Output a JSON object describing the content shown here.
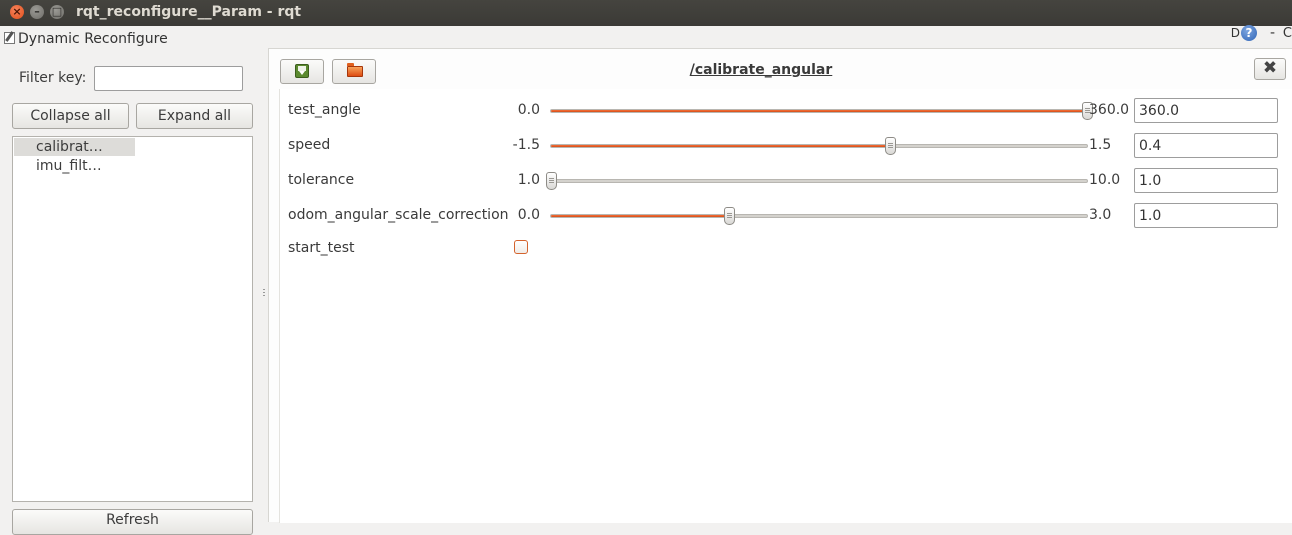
{
  "window": {
    "title": "rqt_reconfigure__Param - rqt",
    "close_glyph": "×",
    "minimize_glyph": "–",
    "maximize_glyph": "□"
  },
  "dock": {
    "title": "Dynamic Reconfigure",
    "d_label": "D",
    "help_glyph": "?",
    "minus_label": "-",
    "close_label": "C"
  },
  "left": {
    "filter_label": "Filter key:",
    "filter_value": "",
    "collapse_label": "Collapse all",
    "expand_label": "Expand all",
    "tree_items": [
      {
        "label": "calibrat…"
      },
      {
        "label": "imu_filt…"
      }
    ],
    "refresh_label": "Refresh"
  },
  "node": {
    "title": "/calibrate_angular",
    "close_glyph": "✖",
    "params": [
      {
        "name": "test_angle",
        "min": "0.0",
        "max": "360.0",
        "value": "360.0",
        "fraction": 1.0
      },
      {
        "name": "speed",
        "min": "-1.5",
        "max": "1.5",
        "value": "0.4",
        "fraction": 0.633
      },
      {
        "name": "tolerance",
        "min": "1.0",
        "max": "10.0",
        "value": "1.0",
        "fraction": 0.0
      },
      {
        "name": "odom_angular_scale_correction",
        "min": "0.0",
        "max": "3.0",
        "value": "1.0",
        "fraction": 0.333
      }
    ],
    "bool_param": {
      "name": "start_test",
      "checked": false
    }
  },
  "colors": {
    "accent": "#e05a24",
    "titlebar": "#3c3b37"
  }
}
